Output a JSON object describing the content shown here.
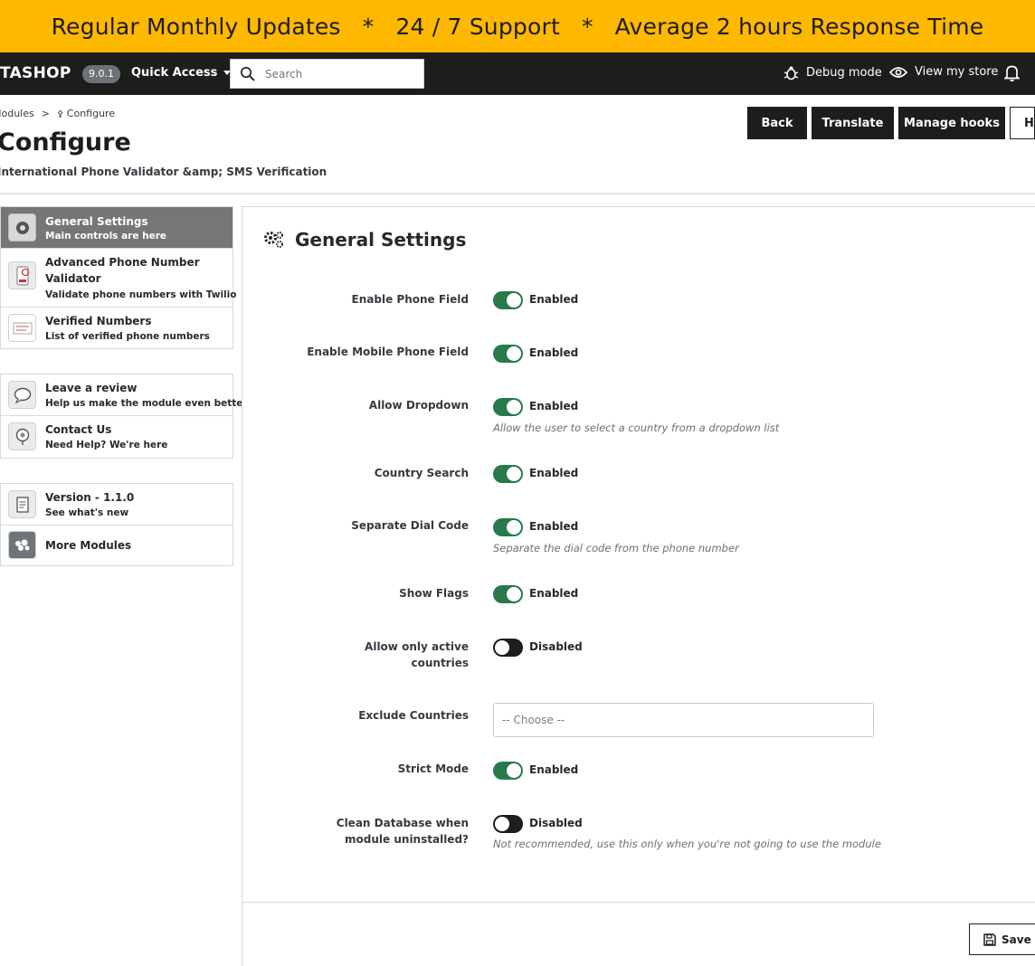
{
  "promo": {
    "item1": "Regular Monthly Updates",
    "item2": "24 / 7 Support",
    "item3": "Average 2 hours Response Time",
    "separator": "*"
  },
  "topnav": {
    "brand": "TASHOP",
    "version": "9.0.1",
    "quick_access": "Quick Access",
    "search_placeholder": "Search",
    "debug_mode": "Debug mode",
    "view_store": "View my store"
  },
  "header": {
    "breadcrumb_parent": "Modules",
    "breadcrumb_sep": ">",
    "breadcrumb_current": "Configure",
    "title": "Configure",
    "subtitle": "International Phone Validator &amp; SMS Verification",
    "buttons": {
      "back": "Back",
      "translate": "Translate",
      "manage_hooks": "Manage hooks",
      "help": "Help"
    }
  },
  "sidebar": {
    "group1": [
      {
        "title": "General Settings",
        "desc": "Main controls are here",
        "icon": "settings-module-icon",
        "active": true
      },
      {
        "title": "Advanced Phone Number Validator",
        "desc": "Validate phone numbers with Twilio",
        "icon": "phone-validator-icon",
        "active": false
      },
      {
        "title": "Verified Numbers",
        "desc": "List of verified phone numbers",
        "icon": "verified-list-icon",
        "active": false
      }
    ],
    "group2": [
      {
        "title": "Leave a review",
        "desc": "Help us make the module even better",
        "icon": "review-bubble-icon"
      },
      {
        "title": "Contact Us",
        "desc": "Need Help? We're here",
        "icon": "contact-support-icon"
      }
    ],
    "group3": [
      {
        "title": "Version - 1.1.0",
        "desc": "See what's new",
        "icon": "changelog-icon"
      },
      {
        "title": "More Modules",
        "icon": "puzzle-modules-icon"
      }
    ]
  },
  "panel": {
    "title": "General Settings",
    "fields": {
      "enable_phone": {
        "label": "Enable Phone Field",
        "state": "Enabled",
        "on": true
      },
      "enable_mobile": {
        "label": "Enable Mobile Phone Field",
        "state": "Enabled",
        "on": true
      },
      "allow_dropdown": {
        "label": "Allow Dropdown",
        "state": "Enabled",
        "on": true,
        "help": "Allow the user to select a country from a dropdown list"
      },
      "country_search": {
        "label": "Country Search",
        "state": "Enabled",
        "on": true
      },
      "separate_dial": {
        "label": "Separate Dial Code",
        "state": "Enabled",
        "on": true,
        "help": "Separate the dial code from the phone number"
      },
      "show_flags": {
        "label": "Show Flags",
        "state": "Enabled",
        "on": true
      },
      "active_countries": {
        "label_line1": "Allow only active",
        "label_line2": "countries",
        "state": "Disabled",
        "on": false
      },
      "exclude_countries": {
        "label": "Exclude Countries",
        "placeholder": "-- Choose --"
      },
      "strict_mode": {
        "label": "Strict Mode",
        "state": "Enabled",
        "on": true
      },
      "clean_db": {
        "label_line1": "Clean Database when",
        "label_line2": "module uninstalled?",
        "state": "Disabled",
        "on": false,
        "help": "Not recommended, use this only when you're not going to use the module"
      }
    },
    "save": "Save"
  },
  "colors": {
    "banner": "#ffb800",
    "nav": "#1d1d1b",
    "toggle_on": "#287a4a",
    "toggle_off": "#1d1d1b",
    "active_item": "#767676"
  }
}
